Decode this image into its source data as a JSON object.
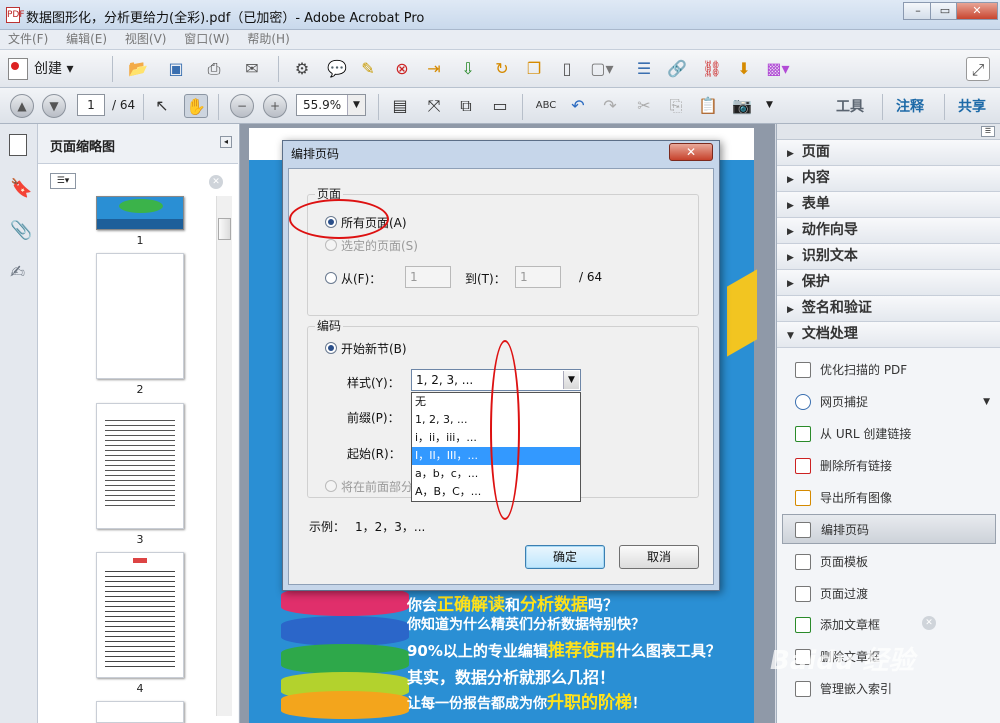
{
  "window": {
    "title": "数据图形化，分析更给力(全彩).pdf（已加密）- Adobe Acrobat Pro",
    "icon_text": "PDF"
  },
  "menu": [
    "文件(F)",
    "编辑(E)",
    "视图(V)",
    "窗口(W)",
    "帮助(H)"
  ],
  "toolbar": {
    "create_label": "创建"
  },
  "nav": {
    "current_page": "1",
    "total_pages": "/ 64",
    "zoom": "55.9%"
  },
  "right_links": {
    "tools": "工具",
    "comment": "注释",
    "share": "共享"
  },
  "left_panel": {
    "title": "页面缩略图",
    "thumbs": [
      "1",
      "2",
      "3",
      "4"
    ]
  },
  "right_panel": {
    "sections": [
      "页面",
      "内容",
      "表单",
      "动作向导",
      "识别文本",
      "保护",
      "签名和验证",
      "文档处理"
    ],
    "items": [
      "优化扫描的 PDF",
      "网页捕捉",
      "从 URL 创建链接",
      "删除所有链接",
      "导出所有图像",
      "编排页码",
      "页面模板",
      "页面过渡",
      "添加文章框",
      "删除文章框",
      "管理嵌入索引"
    ],
    "active_item": "编排页码"
  },
  "dialog": {
    "title": "编排页码",
    "close": "✕",
    "pages_group": "页面",
    "all_pages": "所有页面(A)",
    "selected_pages": "选定的页面(S)",
    "from": "从(F)：",
    "from_value": "1",
    "to": "到(T)：",
    "to_value": "1",
    "of_total": "/ 64",
    "numbering_group": "编码",
    "begin_section": "开始新节(B)",
    "style_label": "样式(Y)：",
    "style_value": "1, 2, 3, ...",
    "prefix_label": "前缀(P)：",
    "start_label": "起始(R)：",
    "extend_label": "将在前面部分",
    "example_label": "示例：",
    "example_value": "1，2，3，...",
    "ok": "确定",
    "cancel": "取消",
    "style_options": [
      "无",
      "1, 2, 3, ...",
      "i，ii，iii，...",
      "I，II，III，...",
      "a，b，c，...",
      "A，B，C，..."
    ],
    "selected_option": 3
  },
  "page_text": {
    "line1a": "你会",
    "line1b": "正确解读",
    "line1c": "和",
    "line1d": "分析数据",
    "line1e": "吗？",
    "line2": "你知道为什么精英们分析数据特别快？",
    "line3a": "90%以上的专业编辑",
    "line3b": "推荐使用",
    "line3c": "什么图表工具？",
    "line4": "其实，数据分析就那么几招！",
    "line5a": "让每一份报告都成为你",
    "line5b": "升职的阶梯",
    "line5c": "！"
  },
  "watermark": "Baidu 经验",
  "colors": {
    "page_blue": "#2a8fd4",
    "highlight": "#ffe21a",
    "select_blue": "#3399ff",
    "annotation_red": "#d11"
  }
}
